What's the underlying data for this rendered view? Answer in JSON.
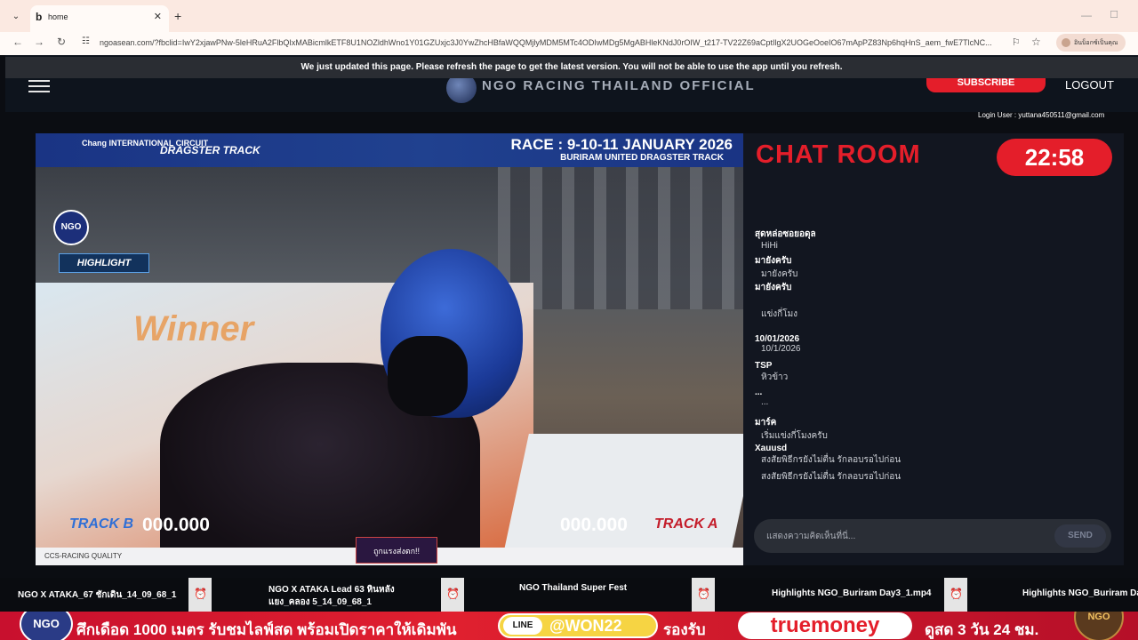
{
  "browser": {
    "tab_title": "home",
    "tab_favicon": "b",
    "url": "ngoasean.com/?fbclid=IwY2xjawPNw-5leHRuA2FlbQIxMABicmlkETF8U1NOZldhWno1Y01GZUxjc3J0YwZhcHBfaWQQMjlyMDM5MTc4ODIwMDg5MgABHleKNdJ0rOIW_t217-TV22Z69aCptIlgX2UOGeOoeIO67mApPZ83Np6hqHnS_aem_fwE7TlcNC...",
    "profile_label": "อินบ็อกซ์เป็นคุณ"
  },
  "notice": "We just updated this page. Please refresh the page to get the latest version. You will not be able to use the app until you refresh.",
  "header": {
    "brand_name": "NGO RACING THAILAND OFFICIAL",
    "subscribe_label": "SUBSCRIBE",
    "logout_label": "LOGOUT",
    "login_user": "Login User : yuttana450511@gmail.com"
  },
  "video": {
    "race_title": "RACE : 9-10-11 JANUARY 2026",
    "race_subtitle": "BURIRAM UNITED DRAGSTER TRACK",
    "sponsor_chang": "Chang INTERNATIONAL CIRCUIT",
    "sponsor_dragster": "DRAGSTER TRACK",
    "highlight_label": "HIGHLIGHT",
    "winner_text": "Winner",
    "track_b_label": "TRACK B",
    "track_b_time": "000.000",
    "track_a_label": "TRACK A",
    "track_a_time": "000.000",
    "ccs_text": "CCS",
    "strip_text": "CCS-RACING QUALITY",
    "strip_badge": "ถูกแรงส่งตก!!"
  },
  "chat": {
    "title": "CHAT ROOM",
    "timer": "22:58",
    "messages": [
      {
        "user": "สุดหล่อซอยอดุล",
        "text": "HiHi"
      },
      {
        "user": "มายังครับ",
        "text": "มายังครับ"
      },
      {
        "user": "มายังครับ",
        "text": ""
      },
      {
        "user": "",
        "text": "แข่งกี่โมง"
      },
      {
        "user": "10/01/2026",
        "text": "10/1/2026"
      },
      {
        "user": "TSP",
        "text": "หิวข้าว"
      },
      {
        "user": "...",
        "text": "..."
      },
      {
        "user": "มาร์ค",
        "text": "เริ่มแข่งกี่โมงครับ"
      },
      {
        "user": "Xauusd",
        "text": "สงสัยพิธีกรยังไม่ตื่น รักลอบรอไปก่อน"
      },
      {
        "user": "",
        "text": "สงสัยพิธีกรยังไม่ตื่น รักลอบรอไปก่อน"
      }
    ],
    "input_placeholder": "แสดงความคิดเห็นที่นี่...",
    "send_label": "SEND"
  },
  "playlist": [
    {
      "title": "NGO X ATAKA_67 ชักเดิน_14_09_68_1",
      "subtitle": ""
    },
    {
      "title": "NGO X ATAKA Lead 63 หินหลัง",
      "subtitle": "แยง_คลอง 5_14_09_68_1"
    },
    {
      "title": "NGO Thailand Super Fest",
      "subtitle": ""
    },
    {
      "title": "Highlights NGO_Buriram Day3_1.mp4",
      "subtitle": ""
    },
    {
      "title": "Highlights NGO_Buriram Da",
      "subtitle": ""
    }
  ],
  "banner": {
    "logo_text": "NGO",
    "headline": "ศึกเดือด 1000 เมตร รับชมไลฟ์สด พร้อมเปิดราคาให้เดิมพัน",
    "line_badge": "LINE",
    "line_id": "@WON22",
    "supports": "รองรับ",
    "wallet": "truemoney",
    "promo": "ดูสด 3 วัน 24 ชม.",
    "mascot_text": "NGO"
  },
  "colors": {
    "accent_red": "#e41e2a",
    "header_bg": "#0e141d",
    "chat_bg": "#121620"
  }
}
